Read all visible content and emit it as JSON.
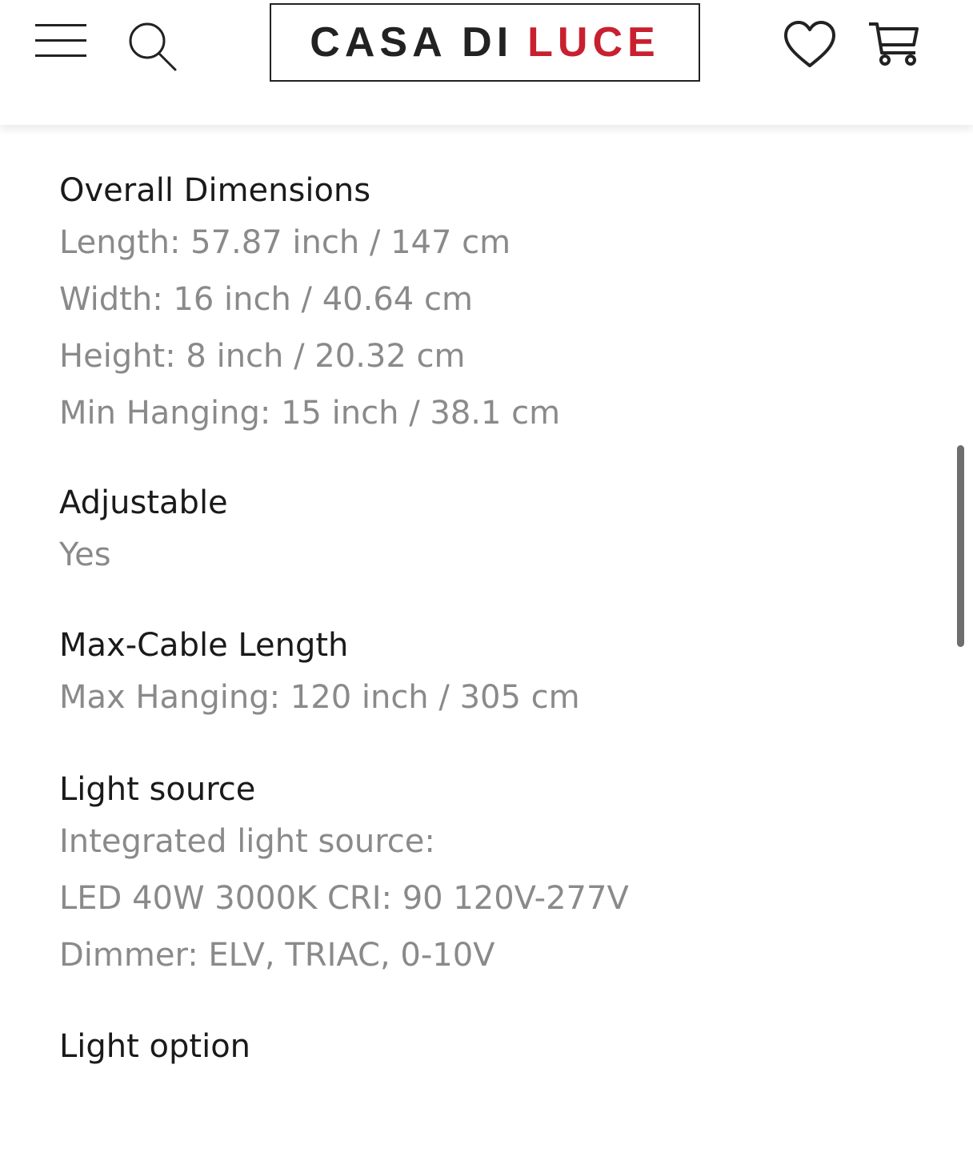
{
  "header": {
    "logo_main": "CASA DI",
    "logo_accent": "LUCE",
    "logo_accent_color": "#c8202f"
  },
  "specs": {
    "dimensions": {
      "title": "Overall Dimensions",
      "lines": [
        "Length: 57.87 inch / 147 cm",
        "Width: 16 inch / 40.64 cm",
        "Height: 8 inch / 20.32 cm",
        "Min Hanging: 15 inch / 38.1 cm"
      ]
    },
    "adjustable": {
      "title": "Adjustable",
      "lines": [
        "Yes"
      ]
    },
    "cable": {
      "title": "Max-Cable Length",
      "lines": [
        "Max Hanging: 120 inch / 305 cm"
      ]
    },
    "light_source": {
      "title": "Light source",
      "lines": [
        "Integrated light source:",
        "LED 40W 3000K CRI: 90 120V-277V",
        "Dimmer: ELV, TRIAC, 0-10V"
      ]
    },
    "light_option": {
      "title": "Light option"
    }
  }
}
